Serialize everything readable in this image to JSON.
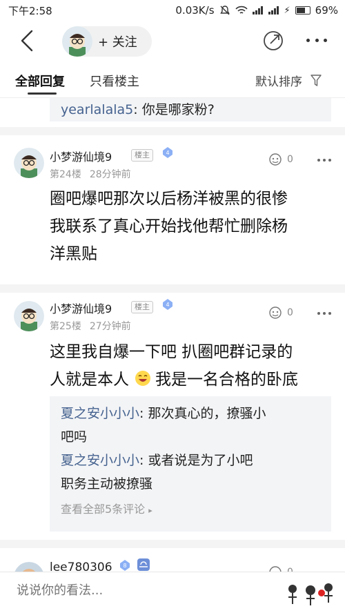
{
  "status": {
    "time": "下午2:58",
    "speed": "0.03K/s",
    "battery": "69%"
  },
  "header": {
    "follow_label": "+ 关注"
  },
  "tabs": {
    "all": "全部回复",
    "owner_only": "只看楼主",
    "sort": "默认排序"
  },
  "prev_reply": {
    "name": "yearlalala5",
    "text": ": 你是哪家粉?"
  },
  "posts": [
    {
      "username": "小梦游仙境9",
      "owner_badge": "楼主",
      "level": "4",
      "floor": "第24楼",
      "time": "28分钟前",
      "likes": "0",
      "lines": [
        "圈吧爆吧那次以后杨洋被黑的很惨",
        "我联系了真心开始找他帮忙删除杨",
        "洋黑贴"
      ]
    },
    {
      "username": "小梦游仙境9",
      "owner_badge": "楼主",
      "level": "4",
      "floor": "第25楼",
      "time": "27分钟前",
      "likes": "0",
      "line1": "这里我自爆一下吧 扒圈吧群记录的",
      "line2a": "人就是本人",
      "line2b": "我是一名合格的卧底",
      "replies": [
        {
          "name": "夏之安小小小",
          "text_a": ": 那次真心的，撩骚小",
          "text_b": "吧吗"
        },
        {
          "name": "夏之安小小小",
          "text_a": ": 或者说是为了小吧",
          "text_b": "职务主动被撩骚"
        }
      ],
      "view_all": "查看全部5条评论"
    },
    {
      "username": "lee780306",
      "level": "8",
      "likes": "0"
    }
  ],
  "bottom": {
    "placeholder": "说说你的看法..."
  },
  "colors": {
    "reply_name": "#45628f",
    "level_badge": "#8cb0f5",
    "reply_bg": "#f3f4f6"
  }
}
